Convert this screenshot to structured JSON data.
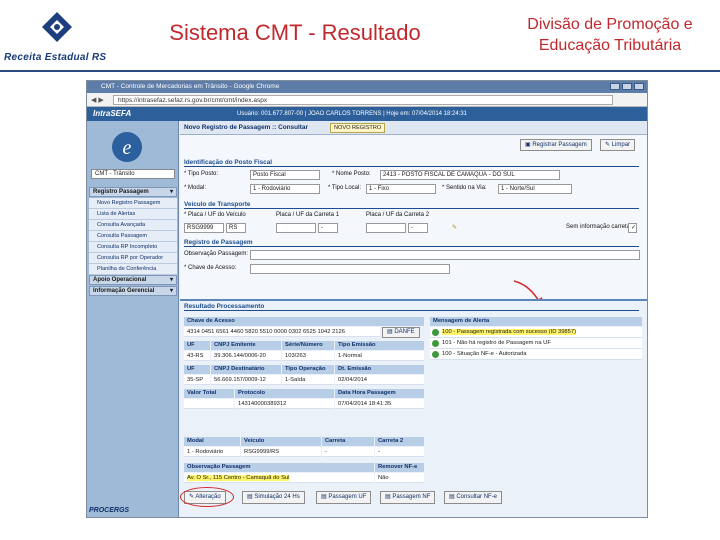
{
  "slide": {
    "title": "Sistema CMT - Resultado",
    "department_line1": "Divisão de Promoção e",
    "department_line2": "Educação Tributária",
    "logo_text": "Receita Estadual RS"
  },
  "window": {
    "title": "CMT - Controle de Mercadorias em Trânsito - Google Chrome",
    "url": "https://intrasefaz.sefaz.rs.gov.br/cmt/cmt/index.aspx"
  },
  "intranet": {
    "logo": "IntraSEFA",
    "user_info": "Usuário: 001.677.807-00  |  JOAO CARLOS TORRENS  |  Hoje em: 07/04/2014 18:24:31"
  },
  "sidebar": {
    "selected_system": "CMT - Trânsito",
    "groups": [
      {
        "label": "Registro Passagem",
        "items": [
          "Novo Registro Passagem",
          "Lista de Alertas",
          "Consulta Avançada",
          "Consulta Passagem",
          "Consulta RP Incompleto",
          "Consulta RP por Operador",
          "Planilha de Conferência"
        ]
      },
      {
        "label": "Apoio Operacional",
        "items": []
      },
      {
        "label": "Informação Gerencial",
        "items": []
      }
    ]
  },
  "main": {
    "page_title": "Novo Registro de Passagem :: Consultar",
    "tab_label": "NOVO REGISTRO",
    "btn_register": "Registrar Passagem",
    "btn_clear": "Limpar",
    "section_local": "Identificação do Posto Fiscal",
    "lbl_tipo_posto": "* Tipo Posto:",
    "val_tipo_posto": "Posto Fiscal",
    "lbl_nome_posto": "* Nome Posto:",
    "val_nome_posto": "2413 - POSTO FISCAL DE CAMAQUÃ - DO SUL",
    "lbl_modal": "* Modal:",
    "val_modal": "1 - Rodoviário",
    "lbl_tipo_local": "* Tipo Local:",
    "val_tipo_local": "1 - Fixo",
    "lbl_sentido": "* Sentido na Via:",
    "val_sentido": "1 - Norte/Sul",
    "section_veiculo": "Veículo de Transporte",
    "lbl_placa": "* Placa / UF do Veículo",
    "val_placa": "RSG9999",
    "val_uf": "RS",
    "lbl_carreta1": "Placa / UF da Carreta 1",
    "lbl_carreta2": "Placa / UF da Carreta 2",
    "val_dash": "-",
    "lbl_sem_carreta": "Sem informação carreta",
    "section_registro": "Registro de Passagem",
    "lbl_obs": "Observação Passagem:",
    "lbl_chave": "* Chave de Acesso:"
  },
  "result": {
    "title": "Resultado Processamento",
    "hdr_chave": "Chave de Acesso",
    "val_chave": "4314 0451 6561 4460 5820 5510 0000 0302 6525 1042 2126",
    "btn_danfe": "DANFE",
    "hdr_alerta": "Mensagem de Alerta",
    "alerts": [
      "100 - Passagem registrada com sucesso (ID 39857)",
      "101 - Não há registro de Passagem na UF",
      "100 - Situação NF-e - Autorizada"
    ],
    "hdr_uf": "UF",
    "hdr_cnpj": "CNPJ Emitente",
    "hdr_serie": "Série/Número",
    "hdr_tipo": "Tipo Emissão",
    "val_uf": "43-RS",
    "val_cnpj": "39.306.144/0006-20",
    "val_serie": "103/263",
    "val_tipo": "1-Normal",
    "hdr_uf2": "UF",
    "hdr_cnpj_dest": "CNPJ Destinatário",
    "hdr_tipo_op": "Tipo Operação",
    "hdr_dt_emissao": "Dt. Emissão",
    "val_uf2": "35-SP",
    "val_cnpj_dest": "56.669.157/0009-12",
    "val_tipo_op": "1-Saída",
    "val_dt_emissao": "02/04/2014",
    "hdr_valor": "Valor Total",
    "hdr_protocolo": "Protocolo",
    "hdr_data_hora": "Data Hora Passagem",
    "val_valor": "",
    "val_protocolo": "143140000389312",
    "val_data_hora": "07/04/2014 18:41:35",
    "hdr_modal": "Modal",
    "hdr_veiculo": "Veículo",
    "hdr_carreta": "Carreta",
    "hdr_carreta2": "Carreta 2",
    "val_modal": "1 - Rodoviário",
    "val_veiculo": "RSG9999/RS",
    "val_carreta": "-",
    "val_carreta2": "-",
    "hdr_obs": "Observação Passagem",
    "hdr_remover": "Remover NF-e",
    "val_obs": "Av. O Sr., 115 Centro - Camaquã do Sul",
    "val_remover": "Não",
    "bottom_buttons": [
      "Alteração",
      "Simulação 24 Hs",
      "Passagem UF",
      "Passagem NF",
      "Consultar NF-e"
    ]
  },
  "footer": {
    "logo": "PROCERGS"
  }
}
